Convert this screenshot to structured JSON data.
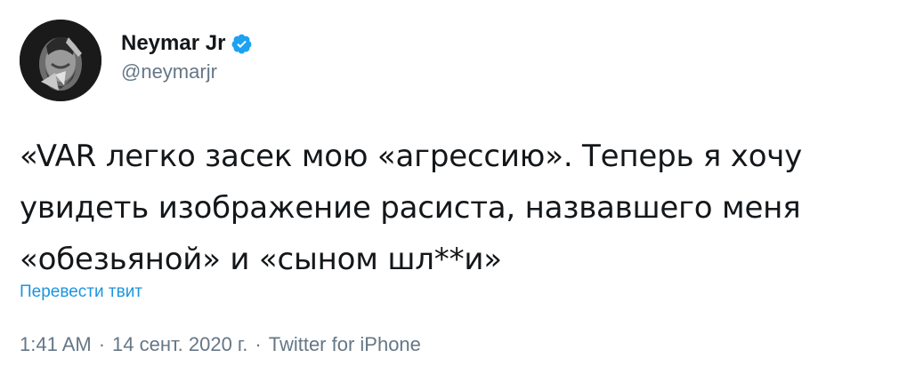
{
  "author": {
    "display_name": "Neymar Jr",
    "handle": "@neymarjr",
    "avatar_icon": "profile-photo",
    "verified_icon": "verified-badge-icon",
    "verified_color": "#1da1f2"
  },
  "tweet": {
    "lines": [
      "«VAR легко засек мою «агрессию». Теперь я хочу",
      "увидеть изображение расиста, назвавшего меня",
      "«обезьяной» и «сыном шл**и»"
    ],
    "translate_label": "Перевести твит",
    "time": "1:41 AM",
    "date": "14 сент. 2020 г.",
    "source": "Twitter for iPhone",
    "separator": "·"
  },
  "colors": {
    "link": "#1b95e0",
    "muted": "#657786",
    "text": "#14171a"
  }
}
